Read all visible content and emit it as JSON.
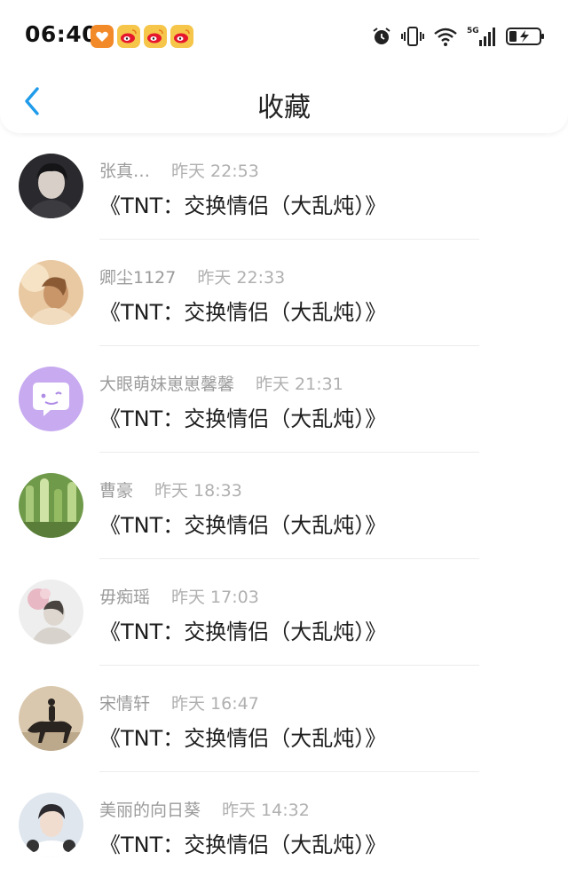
{
  "status_bar": {
    "time": "06:40",
    "notification_icons": [
      "app-orange-icon",
      "weibo-icon",
      "weibo-icon",
      "weibo-icon"
    ],
    "network": "5G"
  },
  "navbar": {
    "back_icon": "chevron-left-icon",
    "title": "收藏",
    "accent_color": "#1f9bea"
  },
  "items": [
    {
      "name": "张真…",
      "date": "昨天 22:53",
      "message": "《TNT：交换情侣（大乱炖）》"
    },
    {
      "name": "卿尘1127",
      "date": "昨天 22:33",
      "message": "《TNT：交换情侣（大乱炖）》"
    },
    {
      "name": "大眼萌妹崽崽馨馨",
      "date": "昨天 21:31",
      "message": "《TNT：交换情侣（大乱炖）》"
    },
    {
      "name": "曹豪",
      "date": "昨天 18:33",
      "message": "《TNT：交换情侣（大乱炖）》"
    },
    {
      "name": "毋痴瑶",
      "date": "昨天 17:03",
      "message": "《TNT：交换情侣（大乱炖）》"
    },
    {
      "name": "宋情轩",
      "date": "昨天 16:47",
      "message": "《TNT：交换情侣（大乱炖）》"
    },
    {
      "name": "美丽的向日葵",
      "date": "昨天 14:32",
      "message": "《TNT：交换情侣（大乱炖）》"
    }
  ]
}
